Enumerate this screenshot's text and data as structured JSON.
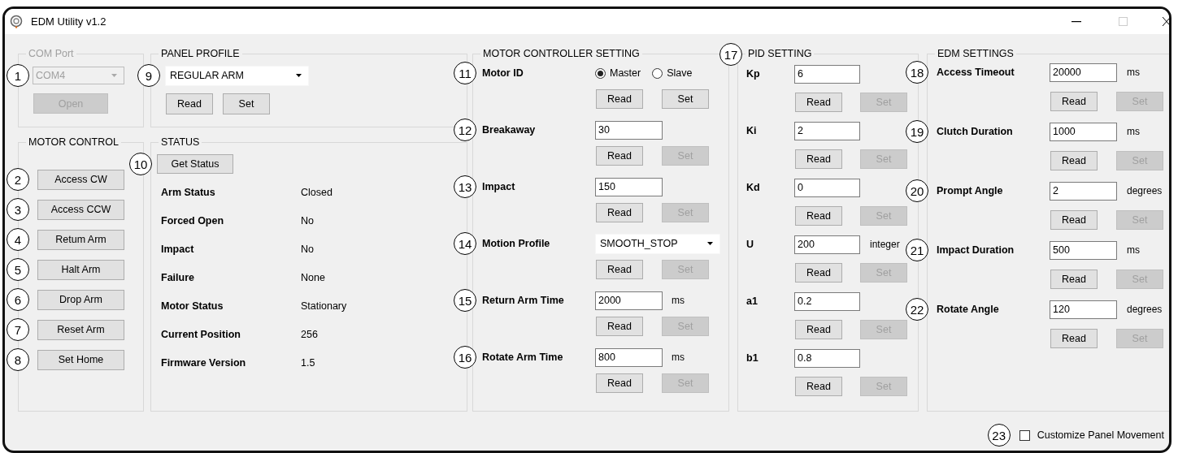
{
  "window": {
    "title": "EDM Utility v1.2"
  },
  "com_port": {
    "title": "COM Port",
    "disabled": true,
    "callout": "1",
    "port": "COM4",
    "open_button": "Open"
  },
  "panel_profile": {
    "title": "PANEL PROFILE",
    "callout": "9",
    "profile": "REGULAR ARM",
    "buttons": [
      {
        "label": "Read",
        "disabled": false
      },
      {
        "label": "Set",
        "disabled": false
      }
    ]
  },
  "motor_control": {
    "title": "MOTOR CONTROL",
    "buttons": [
      {
        "callout": "2",
        "label": "Access CW"
      },
      {
        "callout": "3",
        "label": "Access CCW"
      },
      {
        "callout": "4",
        "label": "Retum Arm"
      },
      {
        "callout": "5",
        "label": "Halt Arm"
      },
      {
        "callout": "6",
        "label": "Drop Arm"
      },
      {
        "callout": "7",
        "label": "Reset Arm"
      },
      {
        "callout": "8",
        "label": "Set Home"
      }
    ]
  },
  "status": {
    "title": "STATUS",
    "callout": "10",
    "button": "Get Status",
    "rows": [
      {
        "label": "Arm Status",
        "value": "Closed"
      },
      {
        "label": "Forced Open",
        "value": "No"
      },
      {
        "label": "Impact",
        "value": "No"
      },
      {
        "label": "Failure",
        "value": "None"
      },
      {
        "label": "Motor Status",
        "value": "Stationary"
      },
      {
        "label": "Current Position",
        "value": "256"
      },
      {
        "label": "Firmware Version",
        "value": "1.5"
      }
    ]
  },
  "motor_controller": {
    "title": "MOTOR CONTROLLER SETTING",
    "settings": [
      {
        "kind": "radio",
        "callout": "11",
        "label": "Motor ID",
        "options": [
          {
            "label": "Master",
            "selected": true
          },
          {
            "label": "Slave",
            "selected": false
          }
        ],
        "read": {
          "label": "Read",
          "disabled": false
        },
        "set": {
          "label": "Set",
          "disabled": false
        }
      },
      {
        "kind": "text",
        "callout": "12",
        "label": "Breakaway",
        "value": "30",
        "read": {
          "label": "Read",
          "disabled": false
        },
        "set": {
          "label": "Set",
          "disabled": true
        }
      },
      {
        "kind": "text",
        "callout": "13",
        "label": "Impact",
        "value": "150",
        "read": {
          "label": "Read",
          "disabled": false
        },
        "set": {
          "label": "Set",
          "disabled": true
        }
      },
      {
        "kind": "dropdown",
        "callout": "14",
        "label": "Motion Profile",
        "value": "SMOOTH_STOP",
        "read": {
          "label": "Read",
          "disabled": false
        },
        "set": {
          "label": "Set",
          "disabled": true
        }
      },
      {
        "kind": "text",
        "callout": "15",
        "label": "Return Arm Time",
        "value": "2000",
        "unit": "ms",
        "read": {
          "label": "Read",
          "disabled": false
        },
        "set": {
          "label": "Set",
          "disabled": true
        }
      },
      {
        "kind": "text",
        "callout": "16",
        "label": "Rotate Arm Time",
        "value": "800",
        "unit": "ms",
        "read": {
          "label": "Read",
          "disabled": false
        },
        "set": {
          "label": "Set",
          "disabled": true
        }
      }
    ]
  },
  "pid": {
    "title": "PID SETTING",
    "callout": "17",
    "settings": [
      {
        "kind": "text",
        "label": "Kp",
        "value": "6",
        "read": {
          "label": "Read",
          "disabled": false
        },
        "set": {
          "label": "Set",
          "disabled": true
        }
      },
      {
        "kind": "text",
        "label": "Ki",
        "value": "2",
        "read": {
          "label": "Read",
          "disabled": false
        },
        "set": {
          "label": "Set",
          "disabled": true
        }
      },
      {
        "kind": "text",
        "label": "Kd",
        "value": "0",
        "read": {
          "label": "Read",
          "disabled": false
        },
        "set": {
          "label": "Set",
          "disabled": true
        }
      },
      {
        "kind": "text",
        "label": "U",
        "value": "200",
        "unit": "integer",
        "read": {
          "label": "Read",
          "disabled": false
        },
        "set": {
          "label": "Set",
          "disabled": true
        }
      },
      {
        "kind": "text",
        "label": "a1",
        "value": "0.2",
        "read": {
          "label": "Read",
          "disabled": false
        },
        "set": {
          "label": "Set",
          "disabled": true
        }
      },
      {
        "kind": "text",
        "label": "b1",
        "value": "0.8",
        "read": {
          "label": "Read",
          "disabled": false
        },
        "set": {
          "label": "Set",
          "disabled": true
        }
      }
    ]
  },
  "edm": {
    "title": "EDM SETTINGS",
    "settings": [
      {
        "kind": "text",
        "callout": "18",
        "label": "Access Timeout",
        "value": "20000",
        "unit": "ms",
        "read": {
          "label": "Read",
          "disabled": false
        },
        "set": {
          "label": "Set",
          "disabled": true
        }
      },
      {
        "kind": "text",
        "callout": "19",
        "label": "Clutch Duration",
        "value": "1000",
        "unit": "ms",
        "read": {
          "label": "Read",
          "disabled": false
        },
        "set": {
          "label": "Set",
          "disabled": true
        }
      },
      {
        "kind": "text",
        "callout": "20",
        "label": "Prompt Angle",
        "value": "2",
        "unit": "degrees",
        "read": {
          "label": "Read",
          "disabled": false
        },
        "set": {
          "label": "Set",
          "disabled": true
        }
      },
      {
        "kind": "text",
        "callout": "21",
        "label": "Impact Duration",
        "value": "500",
        "unit": "ms",
        "read": {
          "label": "Read",
          "disabled": false
        },
        "set": {
          "label": "Set",
          "disabled": true
        }
      },
      {
        "kind": "text",
        "callout": "22",
        "label": "Rotate Angle",
        "value": "120",
        "unit": "degrees",
        "read": {
          "label": "Read",
          "disabled": false
        },
        "set": {
          "label": "Set",
          "disabled": true
        }
      }
    ]
  },
  "customize": {
    "callout": "23",
    "label": "Customize Panel Movement",
    "checked": false
  }
}
